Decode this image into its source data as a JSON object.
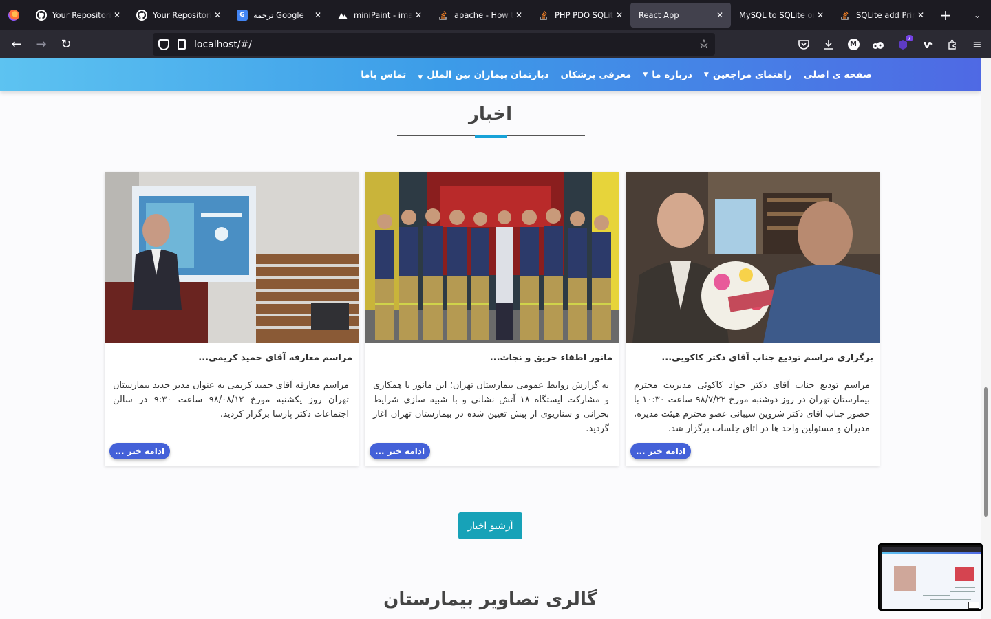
{
  "browser": {
    "tabs": [
      {
        "title": "Your Repositories",
        "icon": "github-icon",
        "active": false
      },
      {
        "title": "Your Repositories",
        "icon": "github-icon",
        "active": false
      },
      {
        "title": "ترجمه Google",
        "icon": "google-translate-icon",
        "active": false
      },
      {
        "title": "miniPaint - image editor",
        "icon": "minipaint-icon",
        "active": false
      },
      {
        "title": "apache - How to",
        "icon": "stackoverflow-icon",
        "active": false
      },
      {
        "title": "PHP PDO SQLite",
        "icon": "stackoverflow-icon",
        "active": false
      },
      {
        "title": "React App",
        "icon": "",
        "active": true
      },
      {
        "title": "MySQL to SQLite online",
        "icon": "",
        "active": false
      },
      {
        "title": "SQLite add Primary",
        "icon": "stackoverflow-icon",
        "active": false
      }
    ],
    "url": "localhost/#/",
    "extensions_badge": "7"
  },
  "site": {
    "nav": [
      {
        "label": "صفحه ی اصلی",
        "dropdown": false
      },
      {
        "label": "راهنمای مراجعین",
        "dropdown": true
      },
      {
        "label": "درباره ما",
        "dropdown": true
      },
      {
        "label": "معرفی پزشکان",
        "dropdown": false
      },
      {
        "label": "دپارتمان بیماران بین الملل",
        "dropdown": true
      },
      {
        "label": "تماس باما",
        "dropdown": false
      }
    ],
    "news_title": "اخبار",
    "news": [
      {
        "title": "برگزاری مراسم تودیع جناب آقای دکتر کاکویی...",
        "body": "مراسم تودیع جناب آقای دکتر جواد کاکوئی مدیریت محترم بیمارستان تهران در روز دوشنبه مورخ ۹۸/۷/۲۲ ساعت ۱۰:۳۰ با حضور جناب آقای دکتر شروین شیبانی عضو محترم هیئت مدیره، مدیران و مسئولین واحد ها در اتاق جلسات برگزار شد.",
        "more": "ادامه خبر ..."
      },
      {
        "title": "مانور اطفاء حریق و نجات...",
        "body": "به گزارش روابط عمومی بیمارستان تهران؛ این مانور با همکاری و مشارکت ایستگاه ۱۸ آتش نشانی و با شبیه سازی شرایط بحرانی و سناریوی از پیش تعیین شده در بیمارستان تهران آغاز گردید.",
        "more": "ادامه خبر ..."
      },
      {
        "title": "مراسم معارفه آقای حمید کریمی...",
        "body": "مراسم معارفه آقای حمید کریمی به عنوان مدیر جدید بیمارستان تهران روز یکشنبه مورخ ۹۸/۰۸/۱۲ ساعت ۹:۳۰ در سالن اجتماعات دکتر پارسا برگزار کردید.",
        "more": "ادامه خبر ..."
      }
    ],
    "archive_button": "آرشیو اخبار",
    "gallery_title": "گالری تصاویر بیمارستان"
  }
}
